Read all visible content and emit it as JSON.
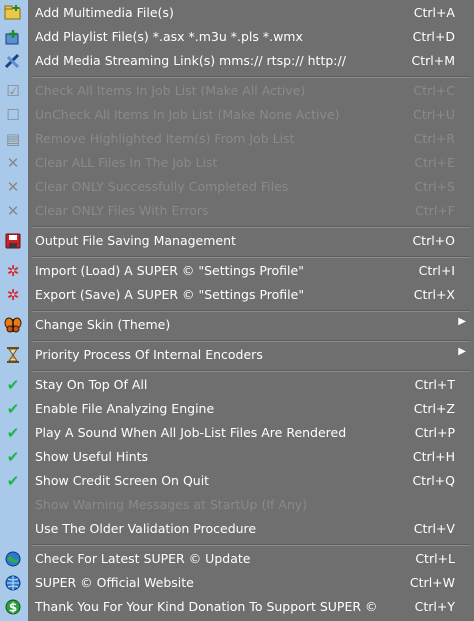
{
  "menu": {
    "items": [
      {
        "label": "Add Multimedia File(s)",
        "shortcut": "Ctrl+A",
        "icon": "add-file-icon"
      },
      {
        "label": "Add Playlist File(s)    *.asx  *.m3u  *.pls  *.wmx",
        "shortcut": "Ctrl+D",
        "icon": "add-playlist-icon"
      },
      {
        "label": "Add Media Streaming Link(s)    mms://   rtsp://   http://",
        "shortcut": "Ctrl+M",
        "icon": "streaming-link-icon"
      },
      {
        "label": "Check All Items In Job List (Make All Active)",
        "shortcut": "Ctrl+C",
        "icon": "check-list-icon"
      },
      {
        "label": "UnCheck All Items In Job List (Make None Active)",
        "shortcut": "Ctrl+U",
        "icon": "uncheck-list-icon"
      },
      {
        "label": "Remove Highlighted Item(s) From Job List",
        "shortcut": "Ctrl+R",
        "icon": "remove-items-icon"
      },
      {
        "label": "Clear ALL Files In The Job List",
        "shortcut": "Ctrl+E",
        "icon": "clear-icon"
      },
      {
        "label": "Clear ONLY Successfully Completed Files",
        "shortcut": "Ctrl+S",
        "icon": "clear-icon"
      },
      {
        "label": "Clear ONLY Files With Errors",
        "shortcut": "Ctrl+F",
        "icon": "clear-icon"
      },
      {
        "label": "Output File Saving Management",
        "shortcut": "Ctrl+O",
        "icon": "floppy-disk-icon"
      },
      {
        "label": "Import (Load) A SUPER © \"Settings Profile\"",
        "shortcut": "Ctrl+I",
        "icon": "import-profile-icon"
      },
      {
        "label": "Export (Save) A SUPER © \"Settings Profile\"",
        "shortcut": "Ctrl+X",
        "icon": "export-profile-icon"
      },
      {
        "label": "Change Skin (Theme)",
        "shortcut": "",
        "icon": "butterfly-icon"
      },
      {
        "label": "Priority Process Of Internal Encoders",
        "shortcut": "",
        "icon": "hourglass-icon"
      },
      {
        "label": "Stay On Top Of All",
        "shortcut": "Ctrl+T",
        "icon": "checkmark-icon"
      },
      {
        "label": "Enable File Analyzing Engine",
        "shortcut": "Ctrl+Z",
        "icon": "checkmark-icon"
      },
      {
        "label": "Play A Sound When All Job-List Files Are Rendered",
        "shortcut": "Ctrl+P",
        "icon": "checkmark-icon"
      },
      {
        "label": "Show Useful Hints",
        "shortcut": "Ctrl+H",
        "icon": "checkmark-icon"
      },
      {
        "label": "Show Credit Screen On Quit",
        "shortcut": "Ctrl+Q",
        "icon": "checkmark-icon"
      },
      {
        "label": "Show Warning Messages at StartUp (If Any)",
        "shortcut": "",
        "icon": ""
      },
      {
        "label": "Use The Older Validation Procedure",
        "shortcut": "Ctrl+V",
        "icon": ""
      },
      {
        "label": "Check For Latest SUPER © Update",
        "shortcut": "Ctrl+L",
        "icon": "globe-update-icon"
      },
      {
        "label": "SUPER © Official Website",
        "shortcut": "Ctrl+W",
        "icon": "globe-website-icon"
      },
      {
        "label": "Thank You For Your Kind Donation To Support SUPER ©",
        "shortcut": "Ctrl+Y",
        "icon": "dollar-icon"
      }
    ]
  },
  "colors": {
    "menu_background": "#6f6f6f",
    "icon_gutter": "#a9c9ea",
    "text_enabled": "#ffffff",
    "text_disabled": "#8a8a8a",
    "check_green": "#22b34a"
  }
}
